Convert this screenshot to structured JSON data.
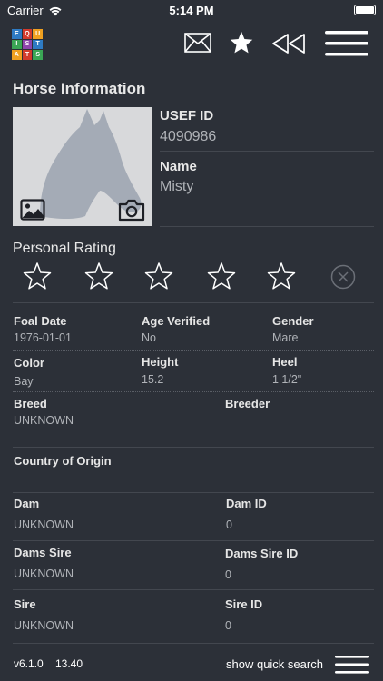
{
  "status": {
    "carrier": "Carrier",
    "time": "5:14 PM"
  },
  "nav": {
    "logo_letters": [
      "E",
      "Q",
      "U",
      "I",
      "S",
      "T",
      "A",
      "T",
      "S"
    ],
    "logo_colors": [
      "#2e7bc4",
      "#d33a2c",
      "#f0a020",
      "#3aa655",
      "#8e44ad",
      "#2e7bc4",
      "#f0a020",
      "#d33a2c",
      "#3aa655"
    ],
    "icons": [
      "mail-icon",
      "star-icon",
      "rewind-icon",
      "menu-icon"
    ]
  },
  "horse": {
    "section_title": "Horse Information",
    "usef_id_label": "USEF ID",
    "usef_id": "4090986",
    "name_label": "Name",
    "name": "Misty"
  },
  "rating": {
    "title": "Personal Rating",
    "stars_filled": 0,
    "stars_total": 5
  },
  "details": {
    "foal_date_label": "Foal Date",
    "foal_date": "1976-01-01",
    "age_verified_label": "Age Verified",
    "age_verified": "No",
    "gender_label": "Gender",
    "gender": "Mare",
    "color_label": "Color",
    "color": "Bay",
    "height_label": "Height",
    "height": "15.2",
    "heel_label": "Heel",
    "heel": "1 1/2\"",
    "breed_label": "Breed",
    "breed": "UNKNOWN",
    "breeder_label": "Breeder",
    "breeder": "",
    "country_label": "Country of Origin",
    "country": "",
    "dam_label": "Dam",
    "dam": "UNKNOWN",
    "dam_id_label": "Dam ID",
    "dam_id": "0",
    "dams_sire_label": "Dams Sire",
    "dams_sire": "UNKNOWN",
    "dams_sire_id_label": "Dams Sire ID",
    "dams_sire_id": "0",
    "sire_label": "Sire",
    "sire": "UNKNOWN",
    "sire_id_label": "Sire ID",
    "sire_id": "0"
  },
  "footer": {
    "version": "v6.1.0",
    "build": "13.40",
    "quick_search": "show quick search"
  }
}
